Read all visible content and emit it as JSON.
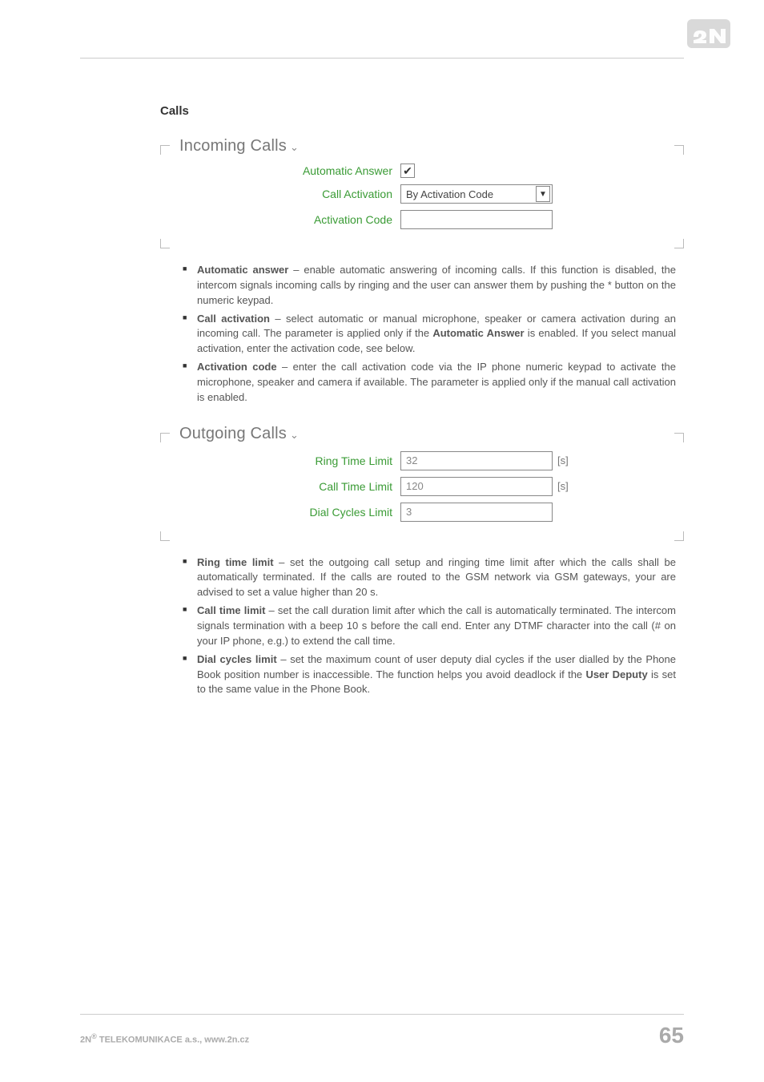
{
  "header": {
    "logo_alt": "2N"
  },
  "calls": {
    "title": "Calls",
    "incoming": {
      "legend": "Incoming Calls",
      "fields": {
        "automatic_answer": {
          "label": "Automatic Answer",
          "checked": true
        },
        "call_activation": {
          "label": "Call Activation",
          "value": "By Activation Code"
        },
        "activation_code": {
          "label": "Activation Code",
          "value": ""
        }
      }
    },
    "desc1": [
      {
        "term": "Automatic answer",
        "text": " – enable automatic answering of incoming calls. If this function is disabled, the intercom signals incoming calls by ringing and the user can answer them by pushing the * button on the numeric keypad."
      },
      {
        "term": "Call activation",
        "text_a": " – select automatic or manual microphone, speaker or camera activation during an incoming call. The parameter is applied only if the ",
        "bold_mid": "Automatic Answer",
        "text_b": " is enabled. If you select manual activation, enter the activation code, see below."
      },
      {
        "term": "Activation code",
        "text": " – enter the call activation code via the IP phone numeric keypad to activate the microphone, speaker and camera if available. The parameter is applied only if the manual call activation is enabled."
      }
    ],
    "outgoing": {
      "legend": "Outgoing Calls",
      "fields": {
        "ring_time_limit": {
          "label": "Ring Time Limit",
          "value": "32",
          "unit": "[s]"
        },
        "call_time_limit": {
          "label": "Call Time Limit",
          "value": "120",
          "unit": "[s]"
        },
        "dial_cycles_limit": {
          "label": "Dial Cycles Limit",
          "value": "3"
        }
      }
    },
    "desc2": [
      {
        "term": "Ring time limit",
        "text": " – set the outgoing call setup and ringing time limit after which the calls shall be automatically terminated. If the calls are routed to the GSM network via GSM gateways, your are advised to set a value higher than 20 s."
      },
      {
        "term": "Call time limit",
        "text": " – set the call duration limit after which the call is automatically terminated. The intercom signals termination with a beep 10 s before the call end. Enter any DTMF character into the call (# on your IP phone, e.g.) to extend the call time."
      },
      {
        "term": "Dial cycles limit",
        "text_a": " – set the maximum count of user deputy dial cycles if the user dialled by the Phone Book position number is inaccessible. The function helps you avoid deadlock if the ",
        "bold_mid": "User Deputy",
        "text_b": " is set to the same value in the Phone Book."
      }
    ]
  },
  "footer": {
    "company": "2N® TELEKOMUNIKACE a.s., www.2n.cz",
    "page": "65"
  }
}
